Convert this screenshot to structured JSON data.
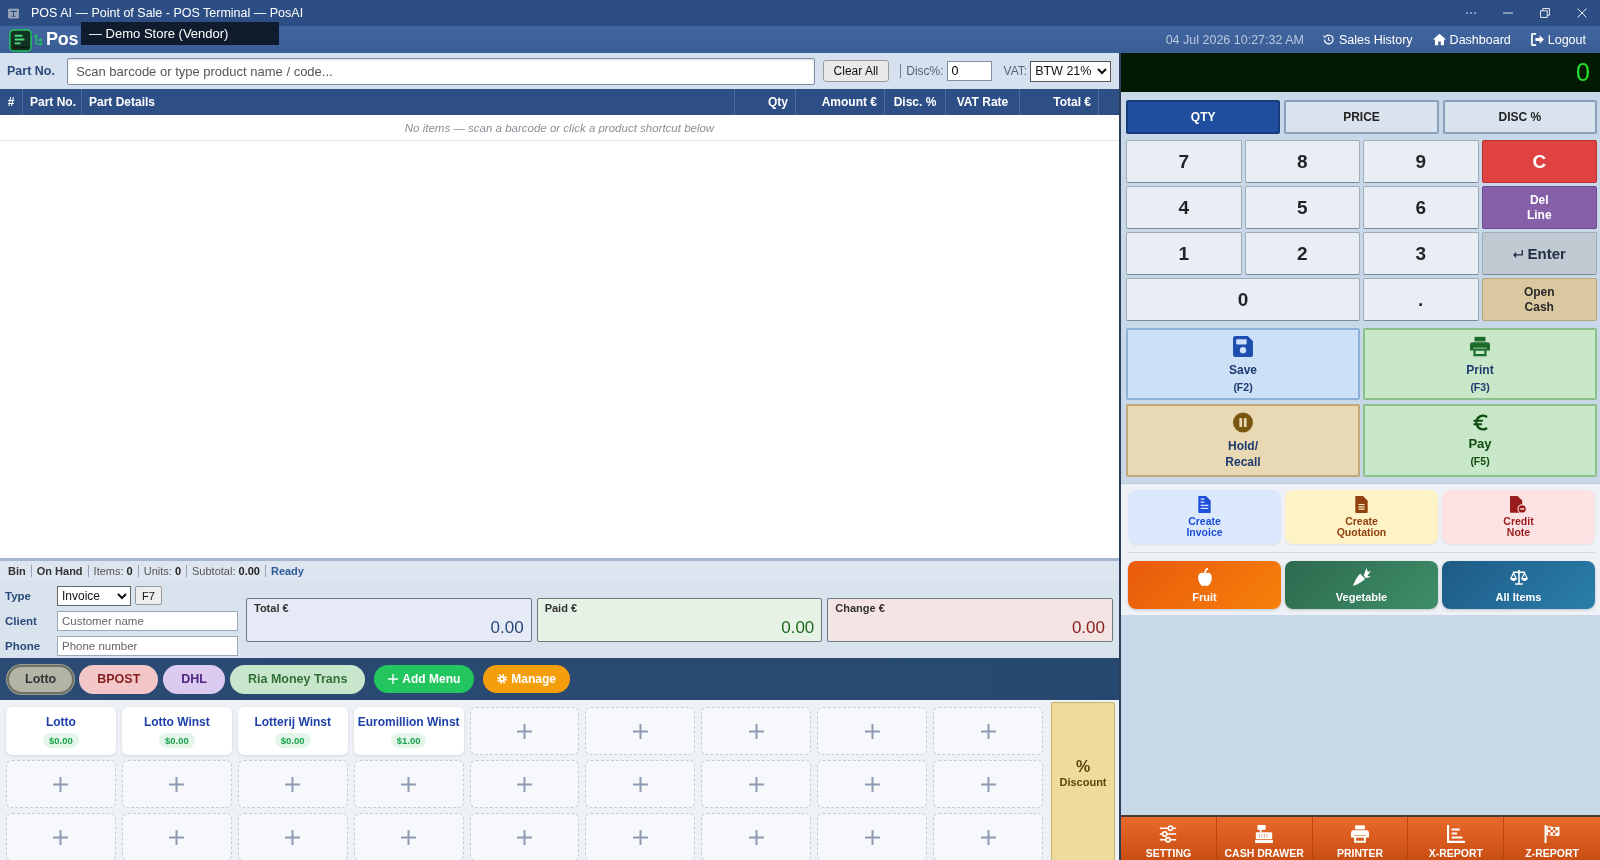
{
  "window": {
    "title": "POS AI — Point of Sale - POS Terminal — PosAI"
  },
  "header": {
    "logo_text": "Pos",
    "tooltip": "— Demo Store (Vendor)",
    "datetime": "04 Jul 2026 10:27:32 AM",
    "links": [
      {
        "label": "Sales History"
      },
      {
        "label": "Dashboard"
      },
      {
        "label": "Logout"
      }
    ]
  },
  "part_entry": {
    "label": "Part No.",
    "placeholder": "Scan barcode or type product name / code...",
    "clear_button": "Clear All",
    "disc_label": "Disc%:",
    "disc_value": "0",
    "vat_label": "VAT:",
    "vat_value": "BTW 21%"
  },
  "table": {
    "columns": [
      {
        "label": "#"
      },
      {
        "label": "Part No."
      },
      {
        "label": "Part Details"
      },
      {
        "label": "Qty"
      },
      {
        "label": "Amount €"
      },
      {
        "label": "Disc. %"
      },
      {
        "label": "VAT Rate"
      },
      {
        "label": "Total €"
      }
    ],
    "empty_message": "No items — scan a barcode or click a product shortcut below"
  },
  "status_bar": {
    "items": [
      {
        "kind": "label",
        "text": "**Bin**"
      },
      {
        "kind": "label",
        "text": "**On Hand**"
      },
      {
        "kind": "count",
        "text": "Items: **0**"
      },
      {
        "kind": "count",
        "text": "Units: **0**"
      },
      {
        "kind": "count",
        "text": "Subtotal: **0.00**"
      },
      {
        "kind": "status",
        "text": "**Ready**"
      }
    ]
  },
  "order_form": {
    "type_label": "Type",
    "type_value": "Invoice",
    "type_shortcut": "F7",
    "client_label": "Client",
    "client_placeholder": "Customer name",
    "phone_label": "Phone",
    "phone_placeholder": "Phone number"
  },
  "totals": [
    {
      "kind": "total",
      "label": "Total €",
      "value": "0.00"
    },
    {
      "kind": "paid",
      "label": "Paid €",
      "value": "0.00"
    },
    {
      "kind": "change",
      "label": "Change €",
      "value": "0.00"
    }
  ],
  "menu_tabs": [
    {
      "label": "Lotto",
      "selected": true,
      "color": "#b3b4a6"
    },
    {
      "label": "BPOST",
      "selected": false,
      "color": "#f3c7c7"
    },
    {
      "label": "DHL",
      "selected": false,
      "color": "#dccbf0"
    },
    {
      "label": "Ria Money Trans",
      "selected": false,
      "color": "#c8e6cb"
    }
  ],
  "add_menu_button": {
    "label": "Add Menu"
  },
  "manage_button": {
    "label": "Manage"
  },
  "shortcuts": [
    {
      "kind": "product",
      "name": "Lotto",
      "price": "$0.00"
    },
    {
      "kind": "product",
      "name": "Lotto Winst",
      "price": "$0.00"
    },
    {
      "kind": "product",
      "name": "Lotterij Winst",
      "price": "$0.00"
    },
    {
      "kind": "product",
      "name": "Euromillion Winst",
      "price": "$1.00"
    },
    {
      "kind": "empty"
    },
    {
      "kind": "empty"
    },
    {
      "kind": "empty"
    },
    {
      "kind": "empty"
    },
    {
      "kind": "empty"
    },
    {
      "kind": "empty"
    },
    {
      "kind": "empty"
    },
    {
      "kind": "empty"
    },
    {
      "kind": "empty"
    },
    {
      "kind": "empty"
    },
    {
      "kind": "empty"
    },
    {
      "kind": "empty"
    },
    {
      "kind": "empty"
    },
    {
      "kind": "empty"
    },
    {
      "kind": "empty"
    },
    {
      "kind": "empty"
    },
    {
      "kind": "empty"
    },
    {
      "kind": "empty"
    },
    {
      "kind": "empty"
    },
    {
      "kind": "empty"
    },
    {
      "kind": "empty"
    },
    {
      "kind": "empty"
    },
    {
      "kind": "empty"
    }
  ],
  "discount_button": {
    "symbol": "%",
    "label": "Discount"
  },
  "display": {
    "value": "0"
  },
  "entry_modes": [
    {
      "label": "QTY",
      "selected": true
    },
    {
      "label": "PRICE",
      "selected": false
    },
    {
      "label": "DISC %",
      "selected": false
    }
  ],
  "keypad": [
    {
      "kind": "digit",
      "label": "7"
    },
    {
      "kind": "digit",
      "label": "8"
    },
    {
      "kind": "digit",
      "label": "9"
    },
    {
      "kind": "clear",
      "label": "C"
    },
    {
      "kind": "digit",
      "label": "4"
    },
    {
      "kind": "digit",
      "label": "5"
    },
    {
      "kind": "digit",
      "label": "6"
    },
    {
      "kind": "delete",
      "label": "Del Line"
    },
    {
      "kind": "digit",
      "label": "1"
    },
    {
      "kind": "digit",
      "label": "2"
    },
    {
      "kind": "digit",
      "label": "3"
    },
    {
      "kind": "enter",
      "label": "Enter"
    },
    {
      "kind": "wide",
      "label": "0"
    },
    {
      "kind": "digit",
      "label": "."
    },
    {
      "kind": "cash",
      "label": "Open Cash"
    }
  ],
  "actions": [
    {
      "kind": "save",
      "label": "Save",
      "shortcut": "(F2)"
    },
    {
      "kind": "print",
      "label": "Print",
      "shortcut": "(F3)"
    },
    {
      "kind": "hold",
      "label": "Hold/ Recall"
    },
    {
      "kind": "pay",
      "label": "Pay",
      "shortcut": "(F5)"
    }
  ],
  "documents": [
    {
      "kind": "invoice",
      "label": "Create Invoice"
    },
    {
      "kind": "quotation",
      "label": "Create Quotation"
    },
    {
      "kind": "credit",
      "label": "Credit Note"
    }
  ],
  "categories": [
    {
      "kind": "fruit",
      "label": "Fruit"
    },
    {
      "kind": "vegetable",
      "label": "Vegetable"
    },
    {
      "kind": "all",
      "label": "All Items"
    }
  ],
  "toolbar": [
    {
      "label": "SETTING"
    },
    {
      "label": "CASH DRAWER"
    },
    {
      "label": "PRINTER"
    },
    {
      "label": "X-REPORT"
    },
    {
      "label": "Z-REPORT"
    }
  ]
}
